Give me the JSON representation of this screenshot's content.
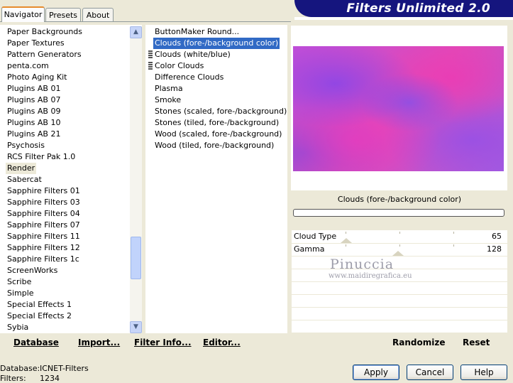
{
  "header": {
    "title": "Filters Unlimited 2.0"
  },
  "tabs": [
    {
      "label": "Navigator",
      "active": true
    },
    {
      "label": "Presets",
      "active": false
    },
    {
      "label": "About",
      "active": false
    }
  ],
  "categories": {
    "items": [
      "Paper Backgrounds",
      "Paper Textures",
      "Pattern Generators",
      "penta.com",
      "Photo Aging Kit",
      "Plugins AB 01",
      "Plugins AB 07",
      "Plugins AB 09",
      "Plugins AB 10",
      "Plugins AB 21",
      "Psychosis",
      "RCS Filter Pak 1.0",
      "Render",
      "Sabercat",
      "Sapphire Filters 01",
      "Sapphire Filters 03",
      "Sapphire Filters 04",
      "Sapphire Filters 07",
      "Sapphire Filters 11",
      "Sapphire Filters 12",
      "Sapphire Filters 1c",
      "ScreenWorks",
      "Scribe",
      "Simple",
      "Special Effects 1",
      "Special Effects 2",
      "Sybia"
    ],
    "selected": "Render"
  },
  "filters": {
    "items": [
      "ButtonMaker Round...",
      "Clouds (fore-/background color)",
      "Clouds (white/blue)",
      "Color Clouds",
      "Difference Clouds",
      "Plasma",
      "Smoke",
      "Stones (scaled, fore-/background)",
      "Stones (tiled, fore-/background)",
      "Wood (scaled, fore-/background)",
      "Wood (tiled, fore-/background)"
    ],
    "selected": "Clouds (fore-/background color)"
  },
  "preview": {
    "filter_name": "Clouds (fore-/background color)"
  },
  "parameters": [
    {
      "name": "Cloud Type",
      "value": "65"
    },
    {
      "name": "Gamma",
      "value": "128"
    }
  ],
  "watermark": {
    "name": "Pinuccia",
    "url": "www.maidiregrafica.eu"
  },
  "links": {
    "database": "Database",
    "import": "Import...",
    "filter_info": "Filter Info...",
    "editor": "Editor...",
    "randomize": "Randomize",
    "reset": "Reset"
  },
  "status": {
    "database_label": "Database:",
    "database_value": "ICNET-Filters",
    "filters_label": "Filters:",
    "filters_value": "1234"
  },
  "buttons": {
    "apply": "Apply",
    "cancel": "Cancel",
    "help": "Help"
  },
  "colors": {
    "banner": "#15157e",
    "selection": "#316ac5",
    "tab_accent": "#e68b2c"
  }
}
